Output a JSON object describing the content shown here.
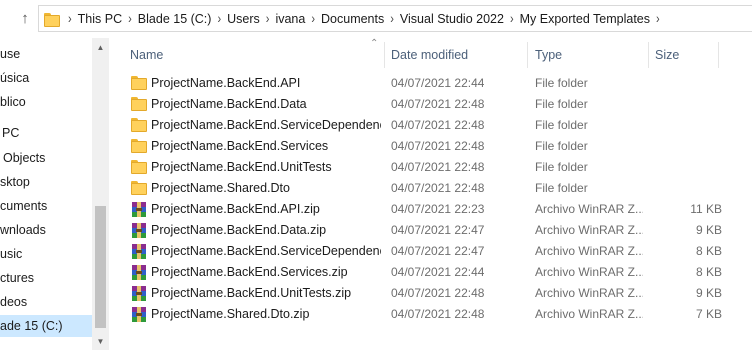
{
  "address_bar": {
    "breadcrumbs": [
      "This PC",
      "Blade 15 (C:)",
      "Users",
      "ivana",
      "Documents",
      "Visual Studio 2022",
      "My Exported Templates"
    ]
  },
  "nav_pane": {
    "items": [
      {
        "label": "use"
      },
      {
        "label": "úsica"
      },
      {
        "label": "blico"
      },
      {
        "label": "PC"
      },
      {
        "label": "Objects"
      },
      {
        "label": "sktop"
      },
      {
        "label": "cuments"
      },
      {
        "label": "wnloads"
      },
      {
        "label": "usic"
      },
      {
        "label": "ctures"
      },
      {
        "label": "deos"
      },
      {
        "label": "ade 15 (C:)",
        "selected": true
      }
    ]
  },
  "columns": {
    "name": "Name",
    "date_modified": "Date modified",
    "type": "Type",
    "size": "Size"
  },
  "files": [
    {
      "name": "ProjectName.BackEnd.API",
      "date": "04/07/2021 22:44",
      "type": "File folder",
      "size": "",
      "icon": "folder-icon"
    },
    {
      "name": "ProjectName.BackEnd.Data",
      "date": "04/07/2021 22:48",
      "type": "File folder",
      "size": "",
      "icon": "folder-icon"
    },
    {
      "name": "ProjectName.BackEnd.ServiceDependenc...",
      "date": "04/07/2021 22:48",
      "type": "File folder",
      "size": "",
      "icon": "folder-icon"
    },
    {
      "name": "ProjectName.BackEnd.Services",
      "date": "04/07/2021 22:48",
      "type": "File folder",
      "size": "",
      "icon": "folder-icon"
    },
    {
      "name": "ProjectName.BackEnd.UnitTests",
      "date": "04/07/2021 22:48",
      "type": "File folder",
      "size": "",
      "icon": "folder-icon"
    },
    {
      "name": "ProjectName.Shared.Dto",
      "date": "04/07/2021 22:48",
      "type": "File folder",
      "size": "",
      "icon": "folder-icon"
    },
    {
      "name": "ProjectName.BackEnd.API.zip",
      "date": "04/07/2021 22:23",
      "type": "Archivo WinRAR Z...",
      "size": "11 KB",
      "icon": "winrar-archive-icon"
    },
    {
      "name": "ProjectName.BackEnd.Data.zip",
      "date": "04/07/2021 22:47",
      "type": "Archivo WinRAR Z...",
      "size": "9 KB",
      "icon": "winrar-archive-icon"
    },
    {
      "name": "ProjectName.BackEnd.ServiceDependenc...",
      "date": "04/07/2021 22:47",
      "type": "Archivo WinRAR Z...",
      "size": "8 KB",
      "icon": "winrar-archive-icon"
    },
    {
      "name": "ProjectName.BackEnd.Services.zip",
      "date": "04/07/2021 22:44",
      "type": "Archivo WinRAR Z...",
      "size": "8 KB",
      "icon": "winrar-archive-icon"
    },
    {
      "name": "ProjectName.BackEnd.UnitTests.zip",
      "date": "04/07/2021 22:48",
      "type": "Archivo WinRAR Z...",
      "size": "9 KB",
      "icon": "winrar-archive-icon"
    },
    {
      "name": "ProjectName.Shared.Dto.zip",
      "date": "04/07/2021 22:48",
      "type": "Archivo WinRAR Z...",
      "size": "7 KB",
      "icon": "winrar-archive-icon"
    }
  ],
  "colors": {
    "selection": "#cce8ff",
    "header_text": "#4c607a",
    "folder_yellow": "#ffd15c"
  }
}
